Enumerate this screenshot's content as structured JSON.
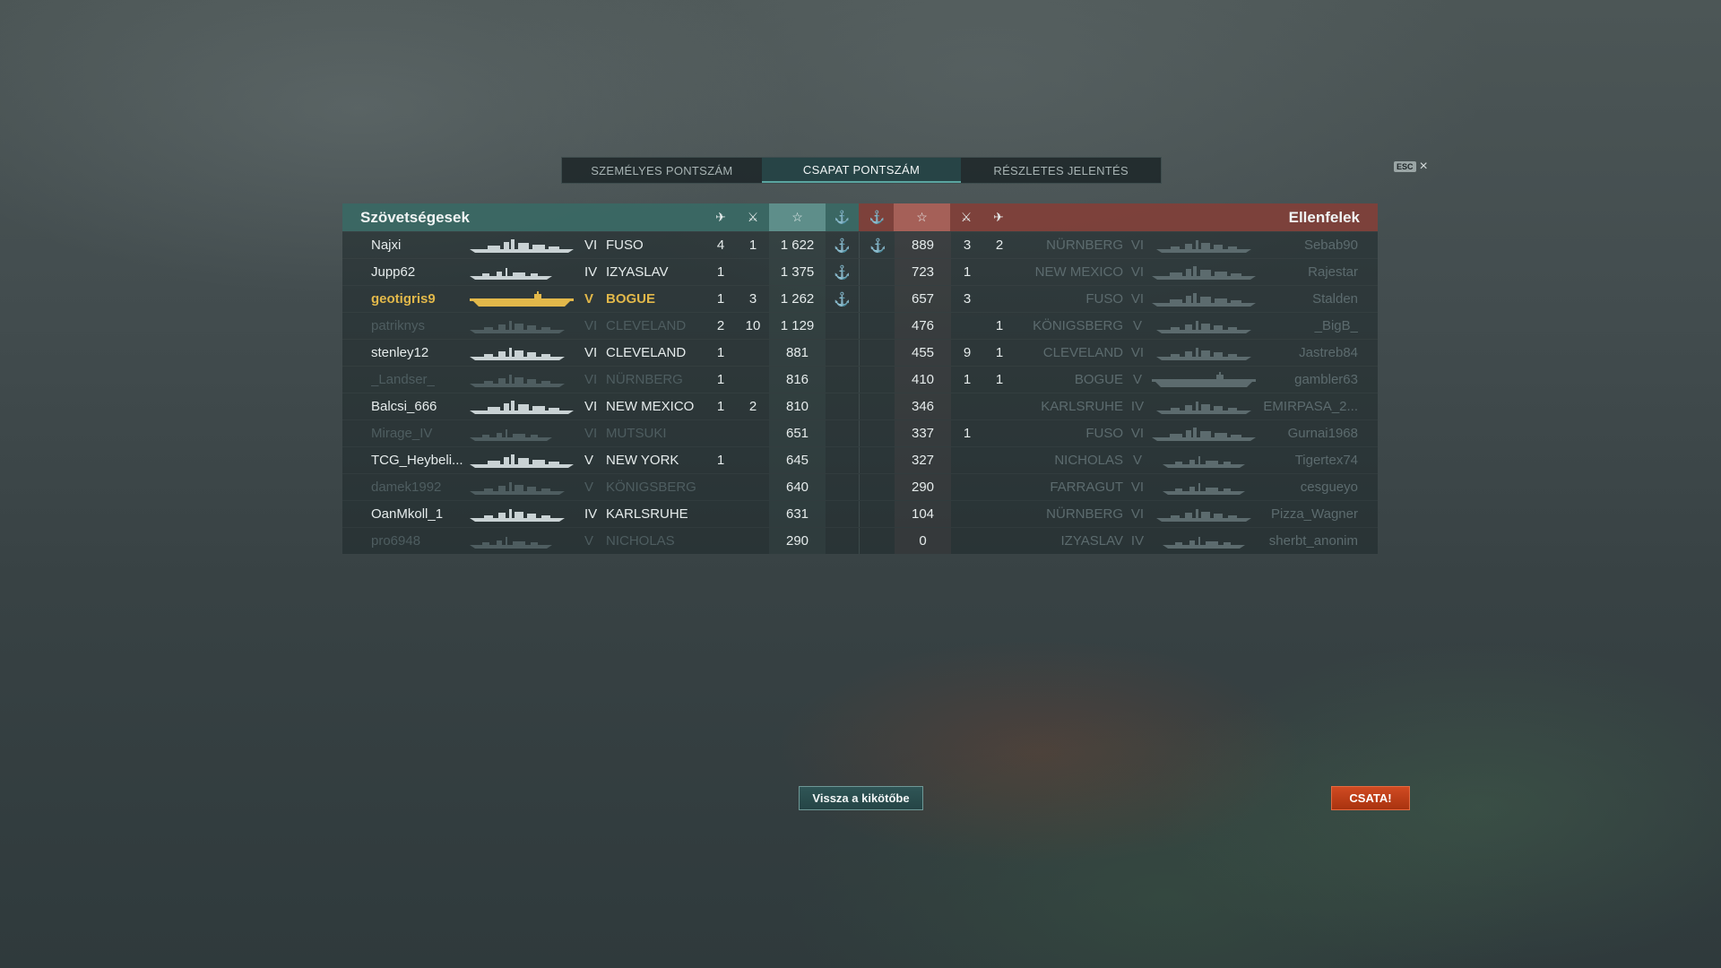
{
  "tabs": [
    {
      "label": "SZEMÉLYES PONTSZÁM",
      "active": false
    },
    {
      "label": "CSAPAT PONTSZÁM",
      "active": true
    },
    {
      "label": "RÉSZLETES JELENTÉS",
      "active": false
    }
  ],
  "esc": {
    "key": "ESC",
    "close": "×"
  },
  "allies": {
    "title": "Szövetségesek",
    "header_icons": [
      "plane-icon",
      "crossed-swords-icon",
      "star-icon",
      "anchor-icon"
    ],
    "header_glyphs": {
      "plane": "✈",
      "kills": "⚔",
      "star": "☆",
      "anchor": "⚓"
    },
    "rows": [
      {
        "name": "Najxi",
        "tier": "VI",
        "ship": "FUSO",
        "planes": "4",
        "kills": "1",
        "score": "1 622",
        "anchor": "⚓",
        "state": "normal",
        "silhouette": "battleship"
      },
      {
        "name": "Jupp62",
        "tier": "IV",
        "ship": "IZYASLAV",
        "planes": "1",
        "kills": "",
        "score": "1 375",
        "anchor": "⚓",
        "state": "normal",
        "silhouette": "destroyer"
      },
      {
        "name": "geotigris9",
        "tier": "V",
        "ship": "BOGUE",
        "planes": "1",
        "kills": "3",
        "score": "1 262",
        "anchor": "⚓",
        "state": "self",
        "silhouette": "carrier"
      },
      {
        "name": "patriknys",
        "tier": "VI",
        "ship": "CLEVELAND",
        "planes": "2",
        "kills": "10",
        "score": "1 129",
        "anchor": "",
        "state": "dead",
        "silhouette": "cruiser"
      },
      {
        "name": "stenley12",
        "tier": "VI",
        "ship": "CLEVELAND",
        "planes": "1",
        "kills": "",
        "score": "881",
        "anchor": "",
        "state": "normal",
        "silhouette": "cruiser"
      },
      {
        "name": "_Landser_",
        "tier": "VI",
        "ship": "NÜRNBERG",
        "planes": "1",
        "kills": "",
        "score": "816",
        "anchor": "",
        "state": "dead",
        "silhouette": "cruiser"
      },
      {
        "name": "Balcsi_666",
        "tier": "VI",
        "ship": "NEW MEXICO",
        "planes": "1",
        "kills": "2",
        "score": "810",
        "anchor": "",
        "state": "normal",
        "silhouette": "battleship"
      },
      {
        "name": "Mirage_IV",
        "tier": "VI",
        "ship": "MUTSUKI",
        "planes": "",
        "kills": "",
        "score": "651",
        "anchor": "",
        "state": "dead",
        "silhouette": "destroyer"
      },
      {
        "name": "TCG_Heybeli...",
        "tier": "V",
        "ship": "NEW YORK",
        "planes": "1",
        "kills": "",
        "score": "645",
        "anchor": "",
        "state": "normal",
        "silhouette": "battleship"
      },
      {
        "name": "damek1992",
        "tier": "V",
        "ship": "KÖNIGSBERG",
        "planes": "",
        "kills": "",
        "score": "640",
        "anchor": "",
        "state": "dead",
        "silhouette": "cruiser"
      },
      {
        "name": "OanMkoll_1",
        "tier": "IV",
        "ship": "KARLSRUHE",
        "planes": "",
        "kills": "",
        "score": "631",
        "anchor": "",
        "state": "normal",
        "silhouette": "cruiser"
      },
      {
        "name": "pro6948",
        "tier": "V",
        "ship": "NICHOLAS",
        "planes": "",
        "kills": "",
        "score": "290",
        "anchor": "",
        "state": "dead",
        "silhouette": "destroyer"
      }
    ]
  },
  "enemies": {
    "title": "Ellenfelek",
    "header_icons": [
      "anchor-icon",
      "star-icon",
      "crossed-swords-icon",
      "plane-icon"
    ],
    "rows": [
      {
        "anchor": "⚓",
        "score": "889",
        "kills": "3",
        "planes": "2",
        "ship": "NÜRNBERG",
        "tier": "VI",
        "name": "Sebab90",
        "silhouette": "cruiser"
      },
      {
        "anchor": "",
        "score": "723",
        "kills": "1",
        "planes": "",
        "ship": "NEW MEXICO",
        "tier": "VI",
        "name": "Rajestar",
        "silhouette": "battleship"
      },
      {
        "anchor": "",
        "score": "657",
        "kills": "3",
        "planes": "",
        "ship": "FUSO",
        "tier": "VI",
        "name": "Stalden",
        "silhouette": "battleship"
      },
      {
        "anchor": "",
        "score": "476",
        "kills": "",
        "planes": "1",
        "ship": "KÖNIGSBERG",
        "tier": "V",
        "name": "_BigB_",
        "silhouette": "cruiser"
      },
      {
        "anchor": "",
        "score": "455",
        "kills": "9",
        "planes": "1",
        "ship": "CLEVELAND",
        "tier": "VI",
        "name": "Jastreb84",
        "silhouette": "cruiser"
      },
      {
        "anchor": "",
        "score": "410",
        "kills": "1",
        "planes": "1",
        "ship": "BOGUE",
        "tier": "V",
        "name": "gambler63",
        "silhouette": "carrier"
      },
      {
        "anchor": "",
        "score": "346",
        "kills": "",
        "planes": "",
        "ship": "KARLSRUHE",
        "tier": "IV",
        "name": "EMIRPASA_2...",
        "silhouette": "cruiser"
      },
      {
        "anchor": "",
        "score": "337",
        "kills": "1",
        "planes": "",
        "ship": "FUSO",
        "tier": "VI",
        "name": "Gurnai1968",
        "silhouette": "battleship"
      },
      {
        "anchor": "",
        "score": "327",
        "kills": "",
        "planes": "",
        "ship": "NICHOLAS",
        "tier": "V",
        "name": "Tigertex74",
        "silhouette": "destroyer"
      },
      {
        "anchor": "",
        "score": "290",
        "kills": "",
        "planes": "",
        "ship": "FARRAGUT",
        "tier": "VI",
        "name": "cesgueyo",
        "silhouette": "destroyer"
      },
      {
        "anchor": "",
        "score": "104",
        "kills": "",
        "planes": "",
        "ship": "NÜRNBERG",
        "tier": "VI",
        "name": "Pizza_Wagner",
        "silhouette": "cruiser"
      },
      {
        "anchor": "",
        "score": "0",
        "kills": "",
        "planes": "",
        "ship": "IZYASLAV",
        "tier": "IV",
        "name": "sherbt_anonim",
        "silhouette": "destroyer"
      }
    ]
  },
  "buttons": {
    "back_to_port": "Vissza a kikötőbe",
    "battle": "CSATA!"
  },
  "colors": {
    "ally_header": "#3a6864",
    "enemy_header": "#80403a",
    "self_highlight": "#e2b84a",
    "anchor": "#c39a48",
    "battle_button": "#c0401a"
  }
}
